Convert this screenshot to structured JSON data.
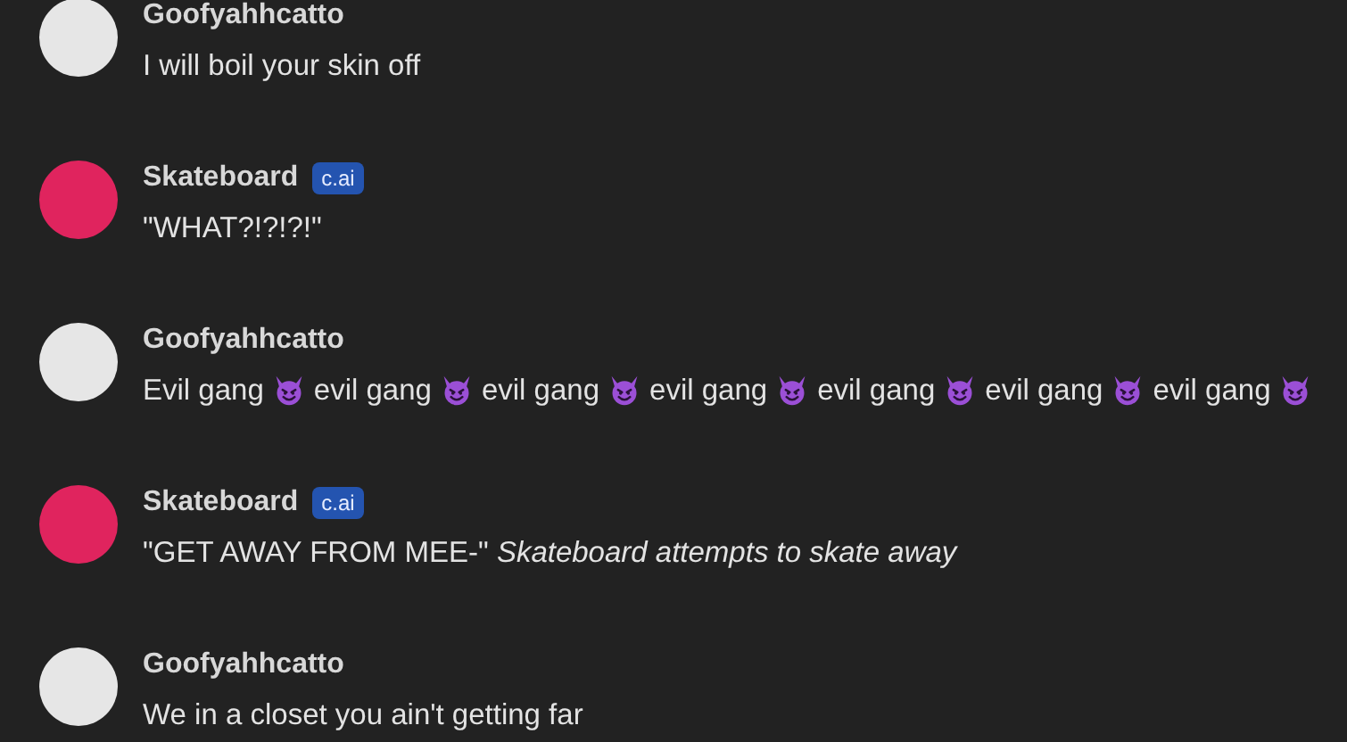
{
  "messages": [
    {
      "author": "Goofyahhcatto",
      "color": "#e6e6e6",
      "parts": [
        {
          "kind": "text",
          "text": "I will boil your skin off"
        }
      ]
    },
    {
      "author": "Skateboard",
      "badge": "c.ai",
      "color": "#e0245e",
      "parts": [
        {
          "kind": "text",
          "text": "\"WHAT?!?!?!\""
        }
      ]
    },
    {
      "author": "Goofyahhcatto",
      "color": "#e6e6e6",
      "parts": [
        {
          "kind": "text",
          "text": "Evil gang"
        },
        {
          "kind": "emoji"
        },
        {
          "kind": "text",
          "text": "evil gang"
        },
        {
          "kind": "emoji"
        },
        {
          "kind": "text",
          "text": "evil gang"
        },
        {
          "kind": "emoji"
        },
        {
          "kind": "text",
          "text": "evil gang"
        },
        {
          "kind": "emoji"
        },
        {
          "kind": "text",
          "text": "evil gang"
        },
        {
          "kind": "emoji"
        },
        {
          "kind": "text",
          "text": "evil gang"
        },
        {
          "kind": "emoji"
        },
        {
          "kind": "text",
          "text": "evil gang"
        },
        {
          "kind": "emoji"
        }
      ]
    },
    {
      "author": "Skateboard",
      "badge": "c.ai",
      "color": "#e0245e",
      "parts": [
        {
          "kind": "text",
          "text": "\"GET AWAY FROM MEE-\" *Skateboard attempts to skate away*"
        }
      ]
    },
    {
      "author": "Goofyahhcatto",
      "color": "#e6e6e6",
      "parts": [
        {
          "kind": "text",
          "text": "We in a closet you ain't getting far"
        }
      ]
    }
  ]
}
